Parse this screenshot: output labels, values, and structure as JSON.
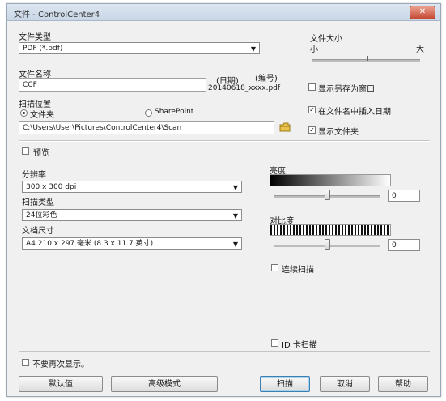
{
  "window": {
    "title": "文件 - ControlCenter4",
    "close": "✕"
  },
  "file_type": {
    "label": "文件类型",
    "value": "PDF (*.pdf)"
  },
  "file_size": {
    "label": "文件大小",
    "small": "小",
    "large": "大",
    "level": 0.55
  },
  "file_name": {
    "label": "文件名称",
    "value": "CCF",
    "date_label": "(日期)",
    "number_label": "(编号)",
    "example": "20140618_xxxx.pdf"
  },
  "show_save_as": {
    "label": "显示另存为窗口",
    "checked": false
  },
  "insert_date": {
    "label": "在文件名中插入日期",
    "checked": true
  },
  "show_folder": {
    "label": "显示文件夹",
    "checked": true
  },
  "scan_location": {
    "label": "扫描位置",
    "folder_option": "文件夹",
    "sharepoint_option": "SharePoint",
    "path": "C:\\Users\\User\\Pictures\\ControlCenter4\\Scan"
  },
  "preview": {
    "label": "预览"
  },
  "resolution": {
    "label": "分辨率",
    "value": "300 x 300 dpi"
  },
  "scan_type": {
    "label": "扫描类型",
    "value": "24位彩色"
  },
  "document_size": {
    "label": "文档尺寸",
    "value": "A4 210 x 297 毫米 (8.3 x 11.7 英寸)"
  },
  "brightness": {
    "label": "亮度",
    "value": "0",
    "level": 0.5
  },
  "contrast": {
    "label": "对比度",
    "value": "0",
    "level": 0.5
  },
  "continuous_scan": {
    "label": "连续扫描"
  },
  "id_card_scan": {
    "label": "ID 卡扫描"
  },
  "dont_show_again": {
    "label": "不要再次显示。"
  },
  "buttons": {
    "default": "默认值",
    "advanced": "高级模式",
    "scan": "扫描",
    "cancel": "取消",
    "help": "帮助"
  },
  "icons": {
    "folder": "folder-icon",
    "dropdown": "chevron-down-icon",
    "close": "close-icon"
  }
}
